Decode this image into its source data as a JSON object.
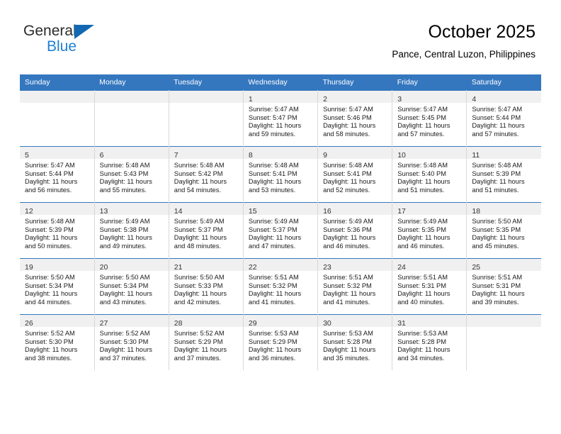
{
  "brand": {
    "name_primary": "General",
    "name_secondary": "Blue",
    "accent_color": "#1268b3",
    "secondary_color": "#1f7fd4"
  },
  "header": {
    "title": "October 2025",
    "subtitle": "Pance, Central Luzon, Philippines"
  },
  "calendar": {
    "header_bg": "#3577bf",
    "weekday_headers": [
      "Sunday",
      "Monday",
      "Tuesday",
      "Wednesday",
      "Thursday",
      "Friday",
      "Saturday"
    ],
    "weeks": [
      [
        {
          "day": ""
        },
        {
          "day": ""
        },
        {
          "day": ""
        },
        {
          "day": "1",
          "sunrise": "Sunrise: 5:47 AM",
          "sunset": "Sunset: 5:47 PM",
          "daylight_1": "Daylight: 11 hours",
          "daylight_2": "and 59 minutes."
        },
        {
          "day": "2",
          "sunrise": "Sunrise: 5:47 AM",
          "sunset": "Sunset: 5:46 PM",
          "daylight_1": "Daylight: 11 hours",
          "daylight_2": "and 58 minutes."
        },
        {
          "day": "3",
          "sunrise": "Sunrise: 5:47 AM",
          "sunset": "Sunset: 5:45 PM",
          "daylight_1": "Daylight: 11 hours",
          "daylight_2": "and 57 minutes."
        },
        {
          "day": "4",
          "sunrise": "Sunrise: 5:47 AM",
          "sunset": "Sunset: 5:44 PM",
          "daylight_1": "Daylight: 11 hours",
          "daylight_2": "and 57 minutes."
        }
      ],
      [
        {
          "day": "5",
          "sunrise": "Sunrise: 5:47 AM",
          "sunset": "Sunset: 5:44 PM",
          "daylight_1": "Daylight: 11 hours",
          "daylight_2": "and 56 minutes."
        },
        {
          "day": "6",
          "sunrise": "Sunrise: 5:48 AM",
          "sunset": "Sunset: 5:43 PM",
          "daylight_1": "Daylight: 11 hours",
          "daylight_2": "and 55 minutes."
        },
        {
          "day": "7",
          "sunrise": "Sunrise: 5:48 AM",
          "sunset": "Sunset: 5:42 PM",
          "daylight_1": "Daylight: 11 hours",
          "daylight_2": "and 54 minutes."
        },
        {
          "day": "8",
          "sunrise": "Sunrise: 5:48 AM",
          "sunset": "Sunset: 5:41 PM",
          "daylight_1": "Daylight: 11 hours",
          "daylight_2": "and 53 minutes."
        },
        {
          "day": "9",
          "sunrise": "Sunrise: 5:48 AM",
          "sunset": "Sunset: 5:41 PM",
          "daylight_1": "Daylight: 11 hours",
          "daylight_2": "and 52 minutes."
        },
        {
          "day": "10",
          "sunrise": "Sunrise: 5:48 AM",
          "sunset": "Sunset: 5:40 PM",
          "daylight_1": "Daylight: 11 hours",
          "daylight_2": "and 51 minutes."
        },
        {
          "day": "11",
          "sunrise": "Sunrise: 5:48 AM",
          "sunset": "Sunset: 5:39 PM",
          "daylight_1": "Daylight: 11 hours",
          "daylight_2": "and 51 minutes."
        }
      ],
      [
        {
          "day": "12",
          "sunrise": "Sunrise: 5:48 AM",
          "sunset": "Sunset: 5:39 PM",
          "daylight_1": "Daylight: 11 hours",
          "daylight_2": "and 50 minutes."
        },
        {
          "day": "13",
          "sunrise": "Sunrise: 5:49 AM",
          "sunset": "Sunset: 5:38 PM",
          "daylight_1": "Daylight: 11 hours",
          "daylight_2": "and 49 minutes."
        },
        {
          "day": "14",
          "sunrise": "Sunrise: 5:49 AM",
          "sunset": "Sunset: 5:37 PM",
          "daylight_1": "Daylight: 11 hours",
          "daylight_2": "and 48 minutes."
        },
        {
          "day": "15",
          "sunrise": "Sunrise: 5:49 AM",
          "sunset": "Sunset: 5:37 PM",
          "daylight_1": "Daylight: 11 hours",
          "daylight_2": "and 47 minutes."
        },
        {
          "day": "16",
          "sunrise": "Sunrise: 5:49 AM",
          "sunset": "Sunset: 5:36 PM",
          "daylight_1": "Daylight: 11 hours",
          "daylight_2": "and 46 minutes."
        },
        {
          "day": "17",
          "sunrise": "Sunrise: 5:49 AM",
          "sunset": "Sunset: 5:35 PM",
          "daylight_1": "Daylight: 11 hours",
          "daylight_2": "and 46 minutes."
        },
        {
          "day": "18",
          "sunrise": "Sunrise: 5:50 AM",
          "sunset": "Sunset: 5:35 PM",
          "daylight_1": "Daylight: 11 hours",
          "daylight_2": "and 45 minutes."
        }
      ],
      [
        {
          "day": "19",
          "sunrise": "Sunrise: 5:50 AM",
          "sunset": "Sunset: 5:34 PM",
          "daylight_1": "Daylight: 11 hours",
          "daylight_2": "and 44 minutes."
        },
        {
          "day": "20",
          "sunrise": "Sunrise: 5:50 AM",
          "sunset": "Sunset: 5:34 PM",
          "daylight_1": "Daylight: 11 hours",
          "daylight_2": "and 43 minutes."
        },
        {
          "day": "21",
          "sunrise": "Sunrise: 5:50 AM",
          "sunset": "Sunset: 5:33 PM",
          "daylight_1": "Daylight: 11 hours",
          "daylight_2": "and 42 minutes."
        },
        {
          "day": "22",
          "sunrise": "Sunrise: 5:51 AM",
          "sunset": "Sunset: 5:32 PM",
          "daylight_1": "Daylight: 11 hours",
          "daylight_2": "and 41 minutes."
        },
        {
          "day": "23",
          "sunrise": "Sunrise: 5:51 AM",
          "sunset": "Sunset: 5:32 PM",
          "daylight_1": "Daylight: 11 hours",
          "daylight_2": "and 41 minutes."
        },
        {
          "day": "24",
          "sunrise": "Sunrise: 5:51 AM",
          "sunset": "Sunset: 5:31 PM",
          "daylight_1": "Daylight: 11 hours",
          "daylight_2": "and 40 minutes."
        },
        {
          "day": "25",
          "sunrise": "Sunrise: 5:51 AM",
          "sunset": "Sunset: 5:31 PM",
          "daylight_1": "Daylight: 11 hours",
          "daylight_2": "and 39 minutes."
        }
      ],
      [
        {
          "day": "26",
          "sunrise": "Sunrise: 5:52 AM",
          "sunset": "Sunset: 5:30 PM",
          "daylight_1": "Daylight: 11 hours",
          "daylight_2": "and 38 minutes."
        },
        {
          "day": "27",
          "sunrise": "Sunrise: 5:52 AM",
          "sunset": "Sunset: 5:30 PM",
          "daylight_1": "Daylight: 11 hours",
          "daylight_2": "and 37 minutes."
        },
        {
          "day": "28",
          "sunrise": "Sunrise: 5:52 AM",
          "sunset": "Sunset: 5:29 PM",
          "daylight_1": "Daylight: 11 hours",
          "daylight_2": "and 37 minutes."
        },
        {
          "day": "29",
          "sunrise": "Sunrise: 5:53 AM",
          "sunset": "Sunset: 5:29 PM",
          "daylight_1": "Daylight: 11 hours",
          "daylight_2": "and 36 minutes."
        },
        {
          "day": "30",
          "sunrise": "Sunrise: 5:53 AM",
          "sunset": "Sunset: 5:28 PM",
          "daylight_1": "Daylight: 11 hours",
          "daylight_2": "and 35 minutes."
        },
        {
          "day": "31",
          "sunrise": "Sunrise: 5:53 AM",
          "sunset": "Sunset: 5:28 PM",
          "daylight_1": "Daylight: 11 hours",
          "daylight_2": "and 34 minutes."
        },
        {
          "day": ""
        }
      ]
    ]
  }
}
